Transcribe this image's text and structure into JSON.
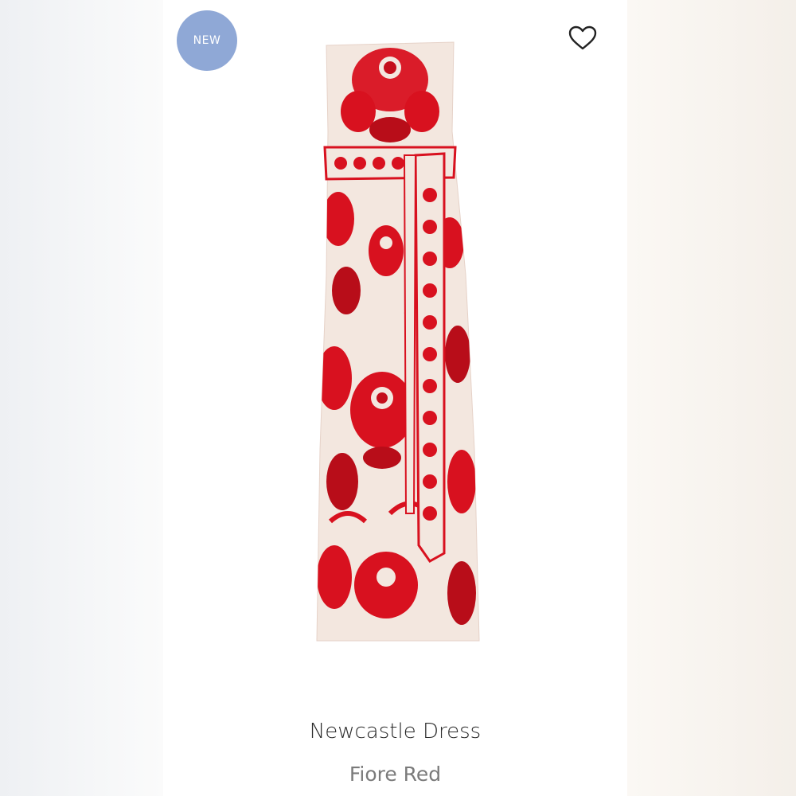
{
  "badge": {
    "label": "NEW"
  },
  "favorite": {
    "icon": "heart-outline-icon"
  },
  "product": {
    "name": "Newcastle Dress",
    "color": "Fiore Red"
  },
  "colors": {
    "badge_bg": "#8fa8d6",
    "print_red": "#d8111f",
    "fabric_cream": "#f3e7df"
  }
}
